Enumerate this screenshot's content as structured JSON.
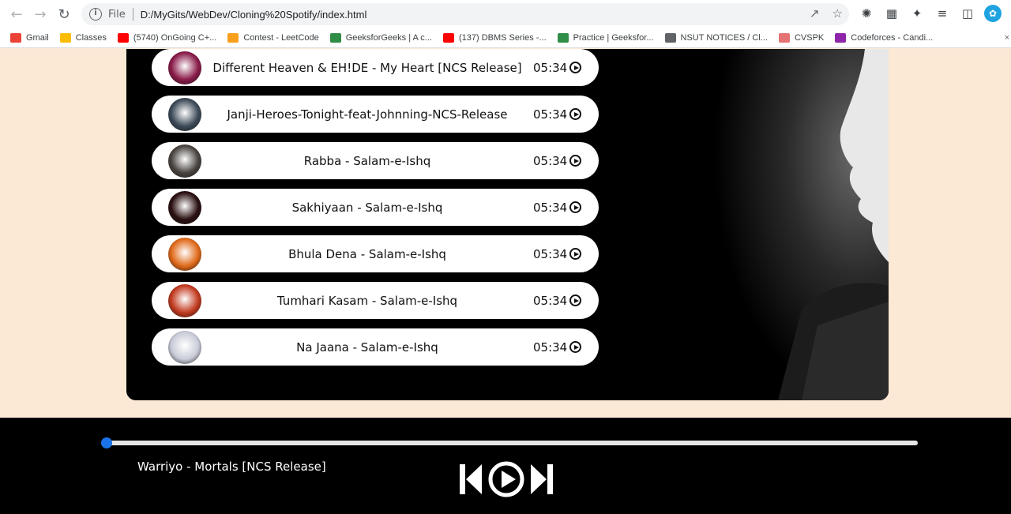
{
  "browser": {
    "file_label": "File",
    "url": "D:/MyGits/WebDev/Cloning%20Spotify/index.html",
    "bookmarks": [
      {
        "label": "Gmail",
        "color": "#ea4335"
      },
      {
        "label": "Classes",
        "color": "#fbbc04"
      },
      {
        "label": "(5740) OnGoing C+...",
        "color": "#ff0000"
      },
      {
        "label": "Contest - LeetCode",
        "color": "#f89f1b"
      },
      {
        "label": "GeeksforGeeks | A c...",
        "color": "#2f8d46"
      },
      {
        "label": "(137) DBMS Series -...",
        "color": "#ff0000"
      },
      {
        "label": "Practice | Geeksfor...",
        "color": "#2f8d46"
      },
      {
        "label": "NSUT NOTICES / Cl...",
        "color": "#5f6368"
      },
      {
        "label": "CVSPK",
        "color": "#e57373"
      },
      {
        "label": "Codeforces - Candi...",
        "color": "#8e24aa"
      }
    ]
  },
  "songs": [
    {
      "name": "Different Heaven & EH!DE - My Heart [NCS Release]",
      "duration": "05:34",
      "cover": "#8a1b4a"
    },
    {
      "name": "Janji-Heroes-Tonight-feat-Johnning-NCS-Release",
      "duration": "05:34",
      "cover": "#3c4a58"
    },
    {
      "name": "Rabba - Salam-e-Ishq",
      "duration": "05:34",
      "cover": "#4a4440"
    },
    {
      "name": "Sakhiyaan - Salam-e-Ishq",
      "duration": "05:34",
      "cover": "#2a1010"
    },
    {
      "name": "Bhula Dena - Salam-e-Ishq",
      "duration": "05:34",
      "cover": "#e06a1a"
    },
    {
      "name": "Tumhari Kasam - Salam-e-Ishq",
      "duration": "05:34",
      "cover": "#c23a20"
    },
    {
      "name": "Na Jaana - Salam-e-Ishq",
      "duration": "05:34",
      "cover": "#c9ccd8"
    }
  ],
  "player": {
    "now_playing": "Warriyo - Mortals [NCS Release]",
    "progress": 0
  }
}
